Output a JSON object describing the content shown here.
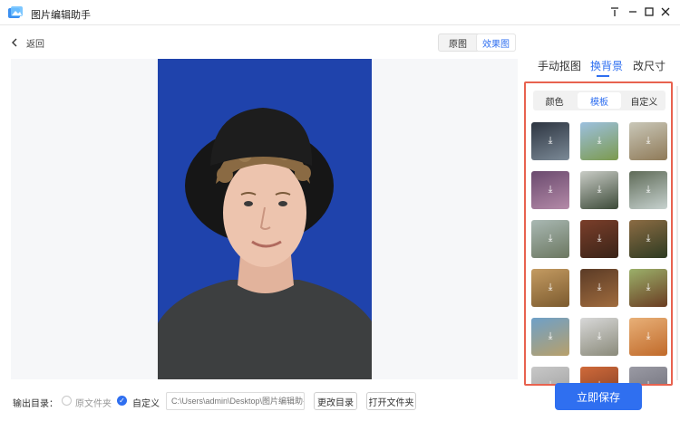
{
  "window": {
    "title": "图片编辑助手"
  },
  "nav": {
    "back_label": "返回"
  },
  "view_toggle": {
    "original": "原图",
    "result": "效果图"
  },
  "side_tabs": [
    {
      "label": "手动抠图"
    },
    {
      "label": "换背景"
    },
    {
      "label": "改尺寸"
    }
  ],
  "bg_modes": [
    {
      "label": "颜色"
    },
    {
      "label": "模板"
    },
    {
      "label": "自定义"
    }
  ],
  "colors": {
    "accent": "#2f6ff0",
    "photo_bg": "#1f43ac",
    "panel_border": "#e8624f"
  },
  "templates": [
    {
      "name": "dark-mountain-road",
      "c1": "#2c3440",
      "c2": "#7c8a97"
    },
    {
      "name": "green-field-road",
      "c1": "#9cc0df",
      "c2": "#7c9a4e"
    },
    {
      "name": "desert-road",
      "c1": "#c9c7b8",
      "c2": "#8f7a58"
    },
    {
      "name": "purple-blossoms",
      "c1": "#6a4a6e",
      "c2": "#b48aa8"
    },
    {
      "name": "foggy-hills",
      "c1": "#c9ccc6",
      "c2": "#3c4a38"
    },
    {
      "name": "mountain-valley",
      "c1": "#5f6b58",
      "c2": "#c7d2cf"
    },
    {
      "name": "forest-road",
      "c1": "#a9b8b3",
      "c2": "#6b7760"
    },
    {
      "name": "bare-tree",
      "c1": "#7a3e2a",
      "c2": "#3a2418"
    },
    {
      "name": "deer",
      "c1": "#8b6b43",
      "c2": "#2e3b22"
    },
    {
      "name": "lion",
      "c1": "#c49b62",
      "c2": "#7b5a2e"
    },
    {
      "name": "bull",
      "c1": "#5b3b26",
      "c2": "#a06c3e"
    },
    {
      "name": "horse",
      "c1": "#9bb06a",
      "c2": "#6a3c22"
    },
    {
      "name": "grazing-animal",
      "c1": "#6ea0c8",
      "c2": "#b8a06a"
    },
    {
      "name": "snow-leopard",
      "c1": "#d8d8d8",
      "c2": "#8a8a7a"
    },
    {
      "name": "fox",
      "c1": "#e8b078",
      "c2": "#c06a2a"
    },
    {
      "name": "partial-1",
      "c1": "#c8c8c8",
      "c2": "#9a9a9a"
    },
    {
      "name": "partial-2",
      "c1": "#d06a3a",
      "c2": "#7a3a22"
    },
    {
      "name": "partial-3",
      "c1": "#9a9aa4",
      "c2": "#6a6a74"
    }
  ],
  "output": {
    "label": "输出目录：",
    "option_original": "原文件夹",
    "option_custom": "自定义",
    "path_placeholder": "C:\\Users\\admin\\Desktop\\图片编辑助手",
    "change_dir": "更改目录",
    "open_folder": "打开文件夹"
  },
  "save": {
    "label": "立即保存"
  }
}
